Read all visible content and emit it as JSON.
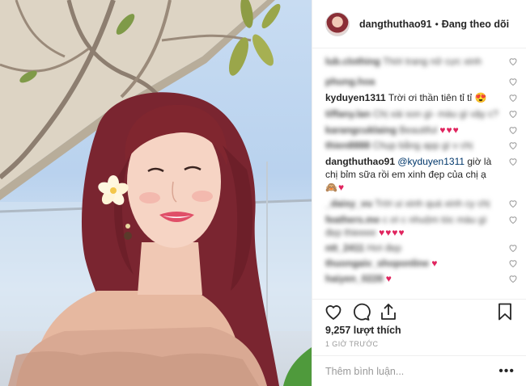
{
  "header": {
    "username": "dangthuthao91",
    "separator": "•",
    "follow_status": "Đang theo dõi"
  },
  "comments": [
    {
      "user": "lub.clothing",
      "text": "Thời trang nữ cực xinh",
      "emoji": "",
      "blurred": true
    },
    {
      "user": "phung.hoa",
      "text": "",
      "emoji": "",
      "blurred": true
    },
    {
      "user": "kyduyen1311",
      "text": "Trời ơi thần tiên tỉ tỉ",
      "emoji": "😍",
      "blurred": false
    },
    {
      "user": "tiffany.lan",
      "text": "Chị xài son gì- màu gì vậy c?",
      "emoji": "",
      "blurred": true
    },
    {
      "user": "karangcuklaing",
      "text": "Beautiful",
      "emoji": "♥♥♥",
      "blurred": true
    },
    {
      "user": "thien8888",
      "text": "Chụp bằng app gì v chị",
      "emoji": "",
      "blurred": true
    },
    {
      "user": "dangthuthao91",
      "mention": "@kyduyen1311",
      "text": "giờ là chị bỉm sữa rồi em xinh đẹp của chị ạ",
      "emoji": "🙈♥",
      "blurred": false
    },
    {
      "user": "_daisy_vu",
      "text": "Trời ui xinh quá xinh cy chị",
      "emoji": "",
      "blurred": true
    },
    {
      "user": "feathers.me",
      "text": "c ơi c nhuộm tóc màu gì đẹp thieeee",
      "emoji": "♥♥♥♥",
      "blurred": true
    },
    {
      "user": "ntt_2411",
      "text": "Hơi đẹp",
      "emoji": "",
      "blurred": true
    },
    {
      "user": "thuongaiv_shoponline",
      "text": "",
      "emoji": "♥",
      "blurred": true
    },
    {
      "user": "haiyen_0228",
      "text": "",
      "emoji": "♥",
      "blurred": true
    }
  ],
  "footer": {
    "likes": "9,257 lượt thích",
    "time": "1 GIỜ TRƯỚC",
    "comment_placeholder": "Thêm bình luận...",
    "more_label": "•••"
  },
  "icons": {
    "like": "heart-outline-icon",
    "comment": "speech-bubble-icon",
    "share": "share-upload-icon",
    "save": "bookmark-icon",
    "comment_like": "small-heart-icon"
  }
}
